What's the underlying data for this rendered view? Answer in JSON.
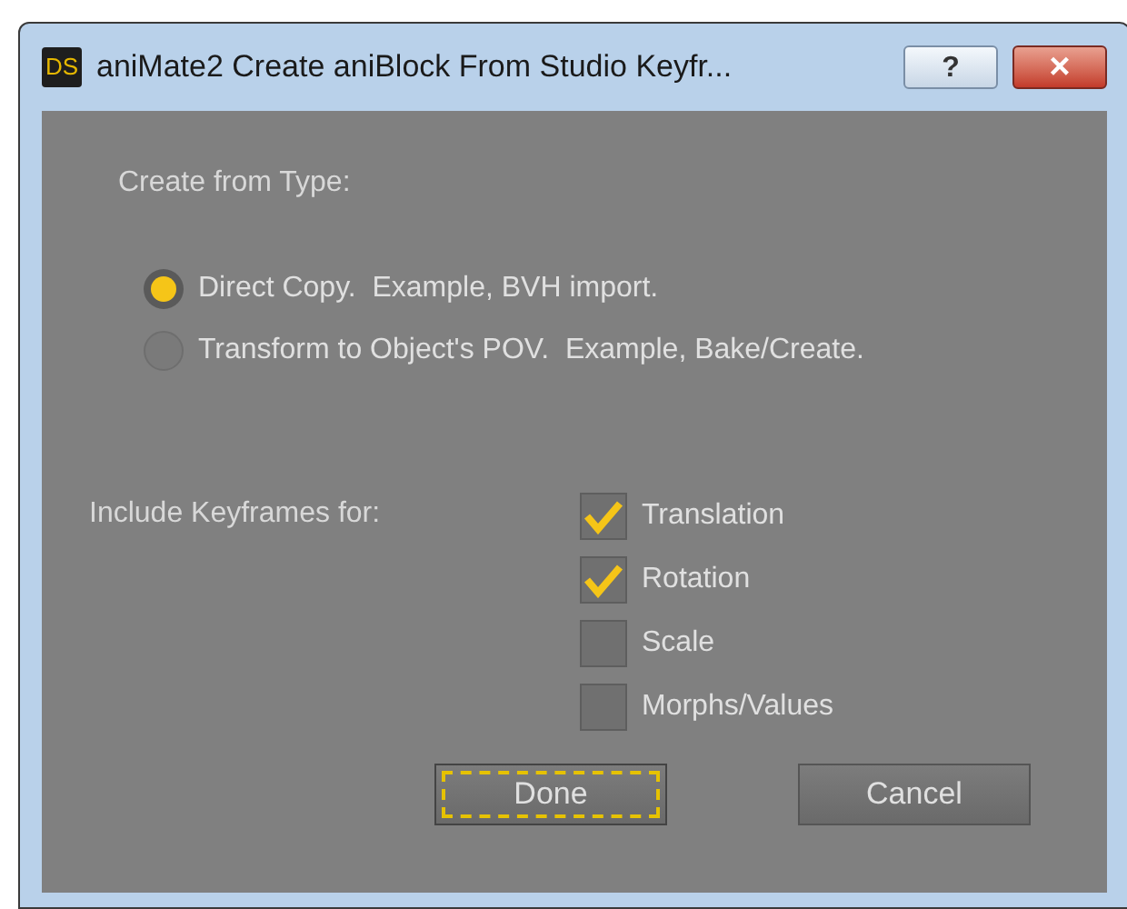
{
  "window": {
    "logo": "DS",
    "title": "aniMate2 Create aniBlock From Studio Keyfr...",
    "help_button": "?",
    "close_button": "×"
  },
  "type_section": {
    "heading": "Create from Type:",
    "options": [
      {
        "label": "Direct Copy.  Example, BVH import.",
        "selected": true
      },
      {
        "label": "Transform to Object's POV.  Example, Bake/Create.",
        "selected": false
      }
    ]
  },
  "keyframes_section": {
    "heading": "Include Keyframes for:",
    "options": [
      {
        "label": "Translation",
        "checked": true
      },
      {
        "label": "Rotation",
        "checked": true
      },
      {
        "label": "Scale",
        "checked": false
      },
      {
        "label": "Morphs/Values",
        "checked": false
      }
    ]
  },
  "buttons": [
    {
      "label": "Done",
      "focused": true
    },
    {
      "label": "Cancel",
      "focused": false
    }
  ]
}
